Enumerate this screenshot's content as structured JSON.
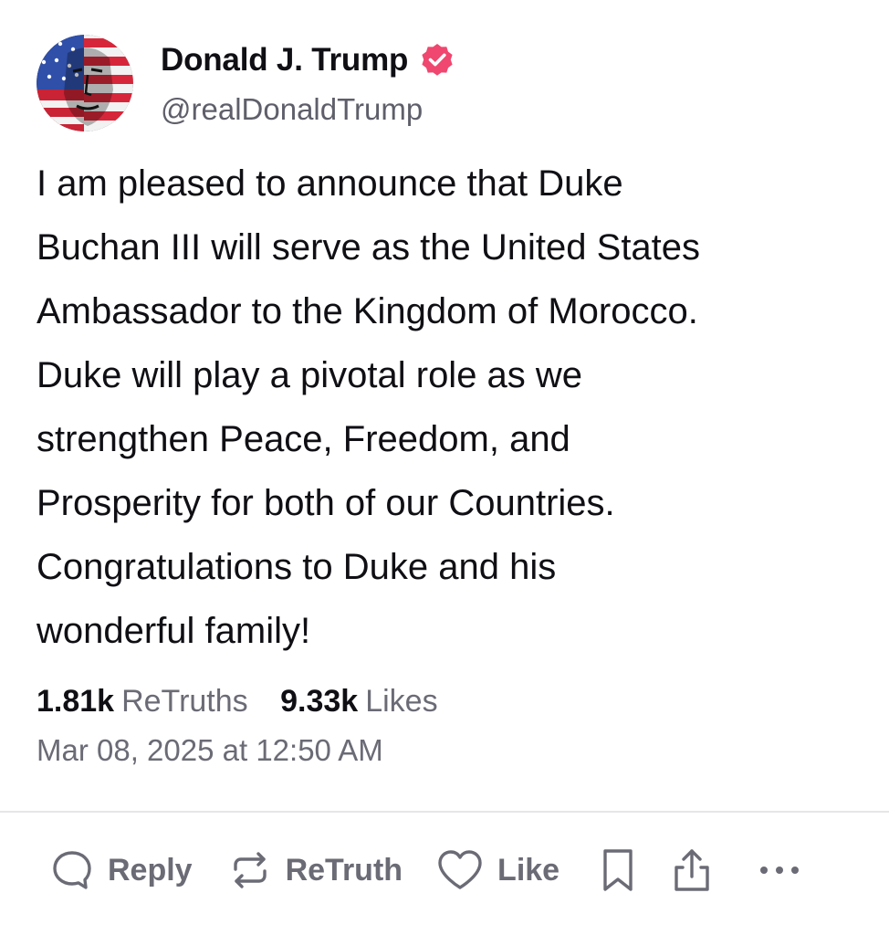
{
  "author": {
    "display_name": "Donald J. Trump",
    "handle": "@realDonaldTrump",
    "verified_color": "#ef476f"
  },
  "post": {
    "text_lines": [
      "I am pleased to announce that Duke",
      "Buchan III will serve as the United States",
      "Ambassador to the Kingdom of Morocco.",
      "Duke will play a pivotal role as we",
      "strengthen Peace, Freedom, and",
      "Prosperity for both of our Countries.",
      "Congratulations to Duke and his",
      "wonderful family!"
    ]
  },
  "stats": {
    "retruths_count": "1.81k",
    "retruths_label": "ReTruths",
    "likes_count": "9.33k",
    "likes_label": "Likes"
  },
  "timestamp": "Mar 08, 2025 at 12:50 AM",
  "actions": {
    "reply_label": "Reply",
    "retruth_label": "ReTruth",
    "like_label": "Like"
  },
  "icons": {
    "reply": "speech-bubble-icon",
    "retruth": "repeat-arrows-icon",
    "like": "heart-icon",
    "bookmark": "bookmark-icon",
    "share": "share-upload-icon",
    "more": "more-dots-icon"
  },
  "colors": {
    "text_primary": "#0f0f14",
    "text_muted": "#6b6b76",
    "divider": "#e6e6ea"
  }
}
